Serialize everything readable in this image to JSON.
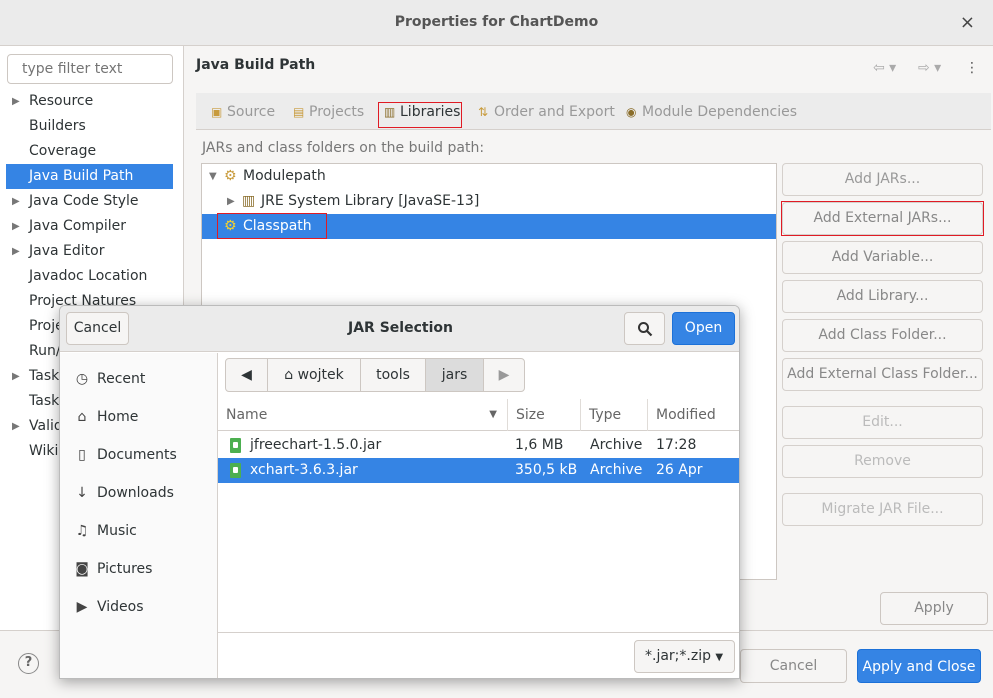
{
  "window": {
    "title": "Properties for ChartDemo",
    "close_symbol": "×"
  },
  "sidebar": {
    "filter_placeholder": "type filter text",
    "items": [
      {
        "label": "Resource",
        "arrow": "▶"
      },
      {
        "label": "Builders",
        "arrow": ""
      },
      {
        "label": "Coverage",
        "arrow": ""
      },
      {
        "label": "Java Build Path",
        "arrow": "",
        "selected": true
      },
      {
        "label": "Java Code Style",
        "arrow": "▶"
      },
      {
        "label": "Java Compiler",
        "arrow": "▶"
      },
      {
        "label": "Java Editor",
        "arrow": "▶"
      },
      {
        "label": "Javadoc Location",
        "arrow": ""
      },
      {
        "label": "Project Natures",
        "arrow": ""
      },
      {
        "label": "Proje",
        "arrow": ""
      },
      {
        "label": "Run/",
        "arrow": ""
      },
      {
        "label": "Task",
        "arrow": "▶"
      },
      {
        "label": "Task",
        "arrow": ""
      },
      {
        "label": "Valid",
        "arrow": "▶"
      },
      {
        "label": "Wiki",
        "arrow": ""
      }
    ]
  },
  "main": {
    "heading": "Java Build Path",
    "tabs": [
      {
        "label": "Source",
        "icon": "source-folder-icon"
      },
      {
        "label": "Projects",
        "icon": "projects-icon"
      },
      {
        "label": "Libraries",
        "icon": "libraries-icon",
        "active": true
      },
      {
        "label": "Order and Export",
        "icon": "order-export-icon"
      },
      {
        "label": "Module Dependencies",
        "icon": "module-icon"
      }
    ],
    "description": "JARs and class folders on the build path:",
    "tree": [
      {
        "label": "Modulepath",
        "arrow": "▼"
      },
      {
        "label": "JRE System Library [JavaSE-13]",
        "arrow": "▶"
      },
      {
        "label": "Classpath",
        "arrow": "",
        "selected": true
      }
    ],
    "buttons": [
      "Add JARs...",
      "Add External JARs...",
      "Add Variable...",
      "Add Library...",
      "Add Class Folder...",
      "Add External Class Folder...",
      "Edit...",
      "Remove",
      "Migrate JAR File..."
    ],
    "apply": "Apply"
  },
  "footer": {
    "help": "?",
    "cancel": "Cancel",
    "apply_and_close": "Apply and Close"
  },
  "dialog": {
    "title": "JAR Selection",
    "cancel": "Cancel",
    "open": "Open",
    "places": [
      {
        "label": "Recent",
        "icon": "clock-icon"
      },
      {
        "label": "Home",
        "icon": "home-icon"
      },
      {
        "label": "Documents",
        "icon": "document-icon"
      },
      {
        "label": "Downloads",
        "icon": "download-icon"
      },
      {
        "label": "Music",
        "icon": "music-icon"
      },
      {
        "label": "Pictures",
        "icon": "camera-icon"
      },
      {
        "label": "Videos",
        "icon": "video-icon"
      }
    ],
    "path": [
      "wojtek",
      "tools",
      "jars"
    ],
    "columns": [
      "Name",
      "Size",
      "Type",
      "Modified"
    ],
    "files": [
      {
        "name": "jfreechart-1.5.0.jar",
        "size": "1,6 MB",
        "type": "Archive",
        "modified": "17:28"
      },
      {
        "name": "xchart-3.6.3.jar",
        "size": "350,5 kB",
        "type": "Archive",
        "modified": "26 Apr",
        "selected": true
      }
    ],
    "file_filter": "*.jar;*.zip"
  },
  "colors": {
    "accent": "#3584e4",
    "highlight_box": "#e01b24",
    "jar_icon": "#4caf50"
  }
}
